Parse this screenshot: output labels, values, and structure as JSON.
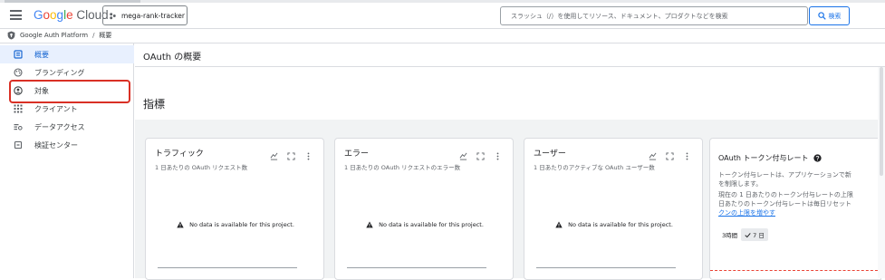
{
  "header": {
    "logo_text": "Google Cloud",
    "project": "mega-rank-tracker",
    "search_placeholder": "スラッシュ（/）を使用してリソース、ドキュメント、プロダクトなどを検索",
    "search_button": "検索"
  },
  "breadcrumb": {
    "root": "Google Auth Platform",
    "separator": "/",
    "current": "概要"
  },
  "sidebar": {
    "items": [
      {
        "label": "概要",
        "icon": "overview-icon",
        "active": true
      },
      {
        "label": "ブランディング",
        "icon": "palette-icon",
        "active": false
      },
      {
        "label": "対象",
        "icon": "audience-icon",
        "active": false
      },
      {
        "label": "クライアント",
        "icon": "grid-icon",
        "active": false
      },
      {
        "label": "データアクセス",
        "icon": "data-access-icon",
        "active": false
      },
      {
        "label": "検証センター",
        "icon": "verification-icon",
        "active": false
      }
    ],
    "highlighted_item": "対象"
  },
  "main": {
    "page_title": "OAuth の概要",
    "section_title": "指標",
    "cards": [
      {
        "title": "トラフィック",
        "subtitle": "1 日あたりの OAuth リクエスト数",
        "empty": "No data is available for this project."
      },
      {
        "title": "エラー",
        "subtitle": "1 日あたりの OAuth リクエストのエラー数",
        "empty": "No data is available for this project."
      },
      {
        "title": "ユーザー",
        "subtitle": "1 日あたりのアクティブな OAuth ユーザー数",
        "empty": "No data is available for this project."
      }
    ],
    "rate_card": {
      "title": "OAuth トークン付与レート",
      "desc_line1": "トークン付与レートは、アプリケーションで新",
      "desc_line2": "を制限します。",
      "limit_line1": "現在の 1 日あたりのトークン付与レートの上限",
      "limit_line2": "日あたりのトークン付与レートは毎日リセット",
      "link_text": "クンの上限を増やす",
      "range_options": [
        "3時間",
        "7 日"
      ],
      "range_selected": "7 日"
    }
  },
  "colors": {
    "accent": "#1a73e8",
    "active_nav_bg": "#e8f0fe",
    "highlight_border": "#d93025"
  }
}
